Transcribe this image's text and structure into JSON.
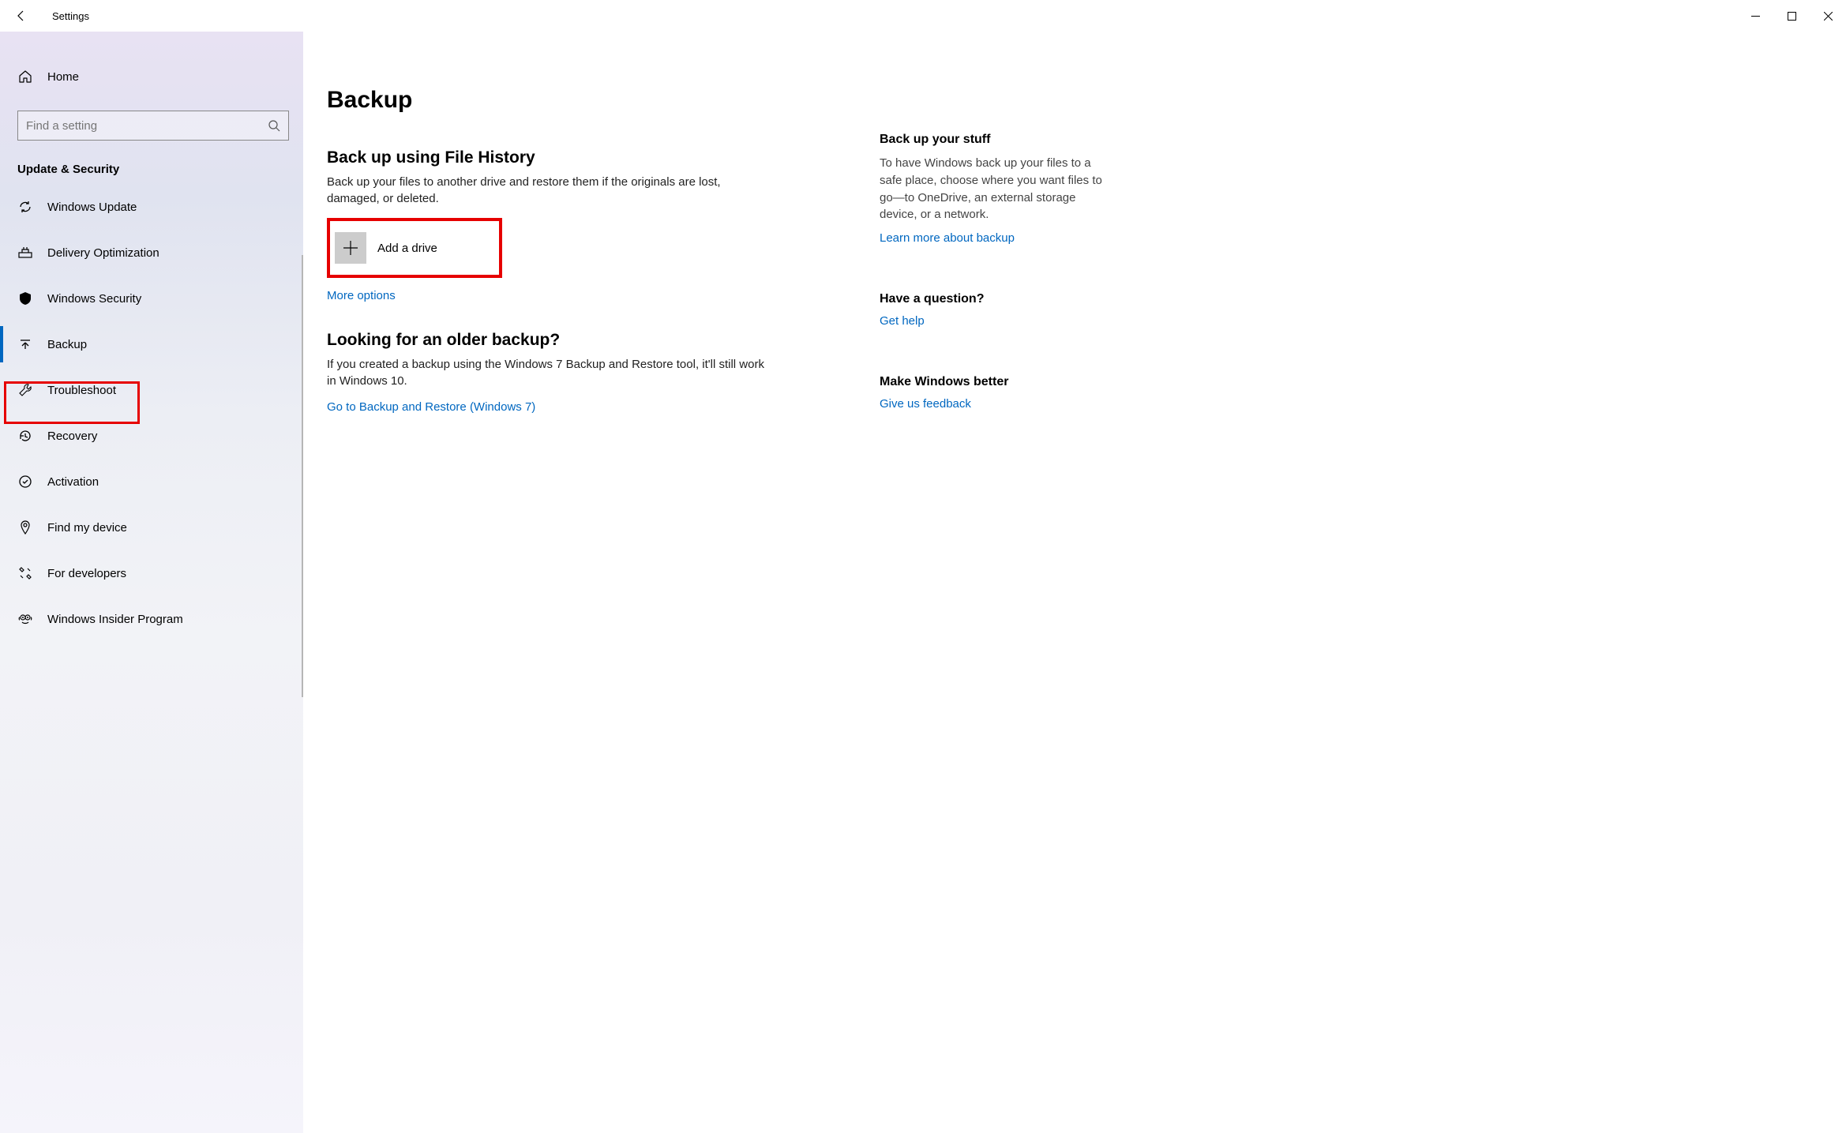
{
  "titlebar": {
    "title": "Settings"
  },
  "sidebar": {
    "home": "Home",
    "search_placeholder": "Find a setting",
    "group_label": "Update & Security",
    "items": [
      {
        "label": "Windows Update"
      },
      {
        "label": "Delivery Optimization"
      },
      {
        "label": "Windows Security"
      },
      {
        "label": "Backup"
      },
      {
        "label": "Troubleshoot"
      },
      {
        "label": "Recovery"
      },
      {
        "label": "Activation"
      },
      {
        "label": "Find my device"
      },
      {
        "label": "For developers"
      },
      {
        "label": "Windows Insider Program"
      }
    ]
  },
  "main": {
    "title": "Backup",
    "section1_h": "Back up using File History",
    "section1_p": "Back up your files to another drive and restore them if the originals are lost, damaged, or deleted.",
    "add_drive_label": "Add a drive",
    "more_options": "More options",
    "section2_h": "Looking for an older backup?",
    "section2_p": "If you created a backup using the Windows 7 Backup and Restore tool, it'll still work in Windows 10.",
    "goto_backup_restore": "Go to Backup and Restore (Windows 7)"
  },
  "right": {
    "h1": "Back up your stuff",
    "p1": "To have Windows back up your files to a safe place, choose where you want files to go—to OneDrive, an external storage device, or a network.",
    "learn_more": "Learn more about backup",
    "h2": "Have a question?",
    "get_help": "Get help",
    "h3": "Make Windows better",
    "feedback": "Give us feedback"
  }
}
